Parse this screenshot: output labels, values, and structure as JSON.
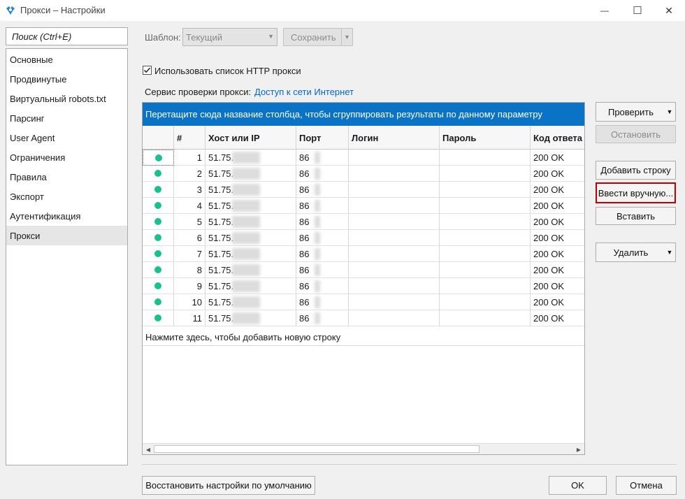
{
  "window": {
    "title": "Прокси – Настройки",
    "minimize_glyph": "—",
    "maximize_glyph": "☐",
    "close_glyph": "✕"
  },
  "search": {
    "placeholder": "Поиск (Ctrl+E)"
  },
  "sidebar": {
    "items": [
      {
        "label": "Основные"
      },
      {
        "label": "Продвинутые"
      },
      {
        "label": "Виртуальный robots.txt"
      },
      {
        "label": "Парсинг"
      },
      {
        "label": "User Agent"
      },
      {
        "label": "Ограничения"
      },
      {
        "label": "Правила"
      },
      {
        "label": "Экспорт"
      },
      {
        "label": "Аутентификация"
      },
      {
        "label": "Прокси",
        "active": true
      }
    ]
  },
  "toolbar": {
    "template_label": "Шаблон:",
    "template_value": "Текущий",
    "save_label": "Сохранить"
  },
  "options": {
    "use_http_proxy_label": "Использовать список HTTP прокси",
    "use_http_proxy_checked": true,
    "check_service_label": "Сервис проверки прокси:",
    "check_service_link": "Доступ к сети Интернет"
  },
  "grid": {
    "group_hint": "Перетащите сюда название столбца, чтобы сгруппировать результаты по данному параметру",
    "columns": [
      "",
      "#",
      "Хост или IP",
      "Порт",
      "Логин",
      "Пароль",
      "Код ответа"
    ],
    "rows": [
      {
        "n": "1",
        "host": "51.75.",
        "port": "86",
        "login": "",
        "password": "",
        "code": "200 OK"
      },
      {
        "n": "2",
        "host": "51.75.",
        "port": "86",
        "login": "",
        "password": "",
        "code": "200 OK"
      },
      {
        "n": "3",
        "host": "51.75.",
        "port": "86",
        "login": "",
        "password": "",
        "code": "200 OK"
      },
      {
        "n": "4",
        "host": "51.75.",
        "port": "86",
        "login": "",
        "password": "",
        "code": "200 OK"
      },
      {
        "n": "5",
        "host": "51.75.",
        "port": "86",
        "login": "",
        "password": "",
        "code": "200 OK"
      },
      {
        "n": "6",
        "host": "51.75.",
        "port": "86",
        "login": "",
        "password": "",
        "code": "200 OK"
      },
      {
        "n": "7",
        "host": "51.75.",
        "port": "86",
        "login": "",
        "password": "",
        "code": "200 OK"
      },
      {
        "n": "8",
        "host": "51.75.",
        "port": "86",
        "login": "",
        "password": "",
        "code": "200 OK"
      },
      {
        "n": "9",
        "host": "51.75.",
        "port": "86",
        "login": "",
        "password": "",
        "code": "200 OK"
      },
      {
        "n": "10",
        "host": "51.75.",
        "port": "86",
        "login": "",
        "password": "",
        "code": "200 OK"
      },
      {
        "n": "11",
        "host": "51.75.",
        "port": "86",
        "login": "",
        "password": "",
        "code": "200 OK"
      }
    ],
    "status_color": "#1ac08f",
    "add_row_hint": "Нажмите здесь, чтобы добавить новую строку"
  },
  "actions": {
    "check_label": "Проверить",
    "stop_label": "Остановить",
    "add_row_label": "Добавить строку",
    "manual_label": "Ввести вручную...",
    "paste_label": "Вставить",
    "delete_label": "Удалить"
  },
  "footer": {
    "restore_label": "Восстановить настройки по умолчанию",
    "ok_label": "OK",
    "cancel_label": "Отмена"
  },
  "colors": {
    "accent": "#0a73c6",
    "highlight_border": "#c00000"
  }
}
